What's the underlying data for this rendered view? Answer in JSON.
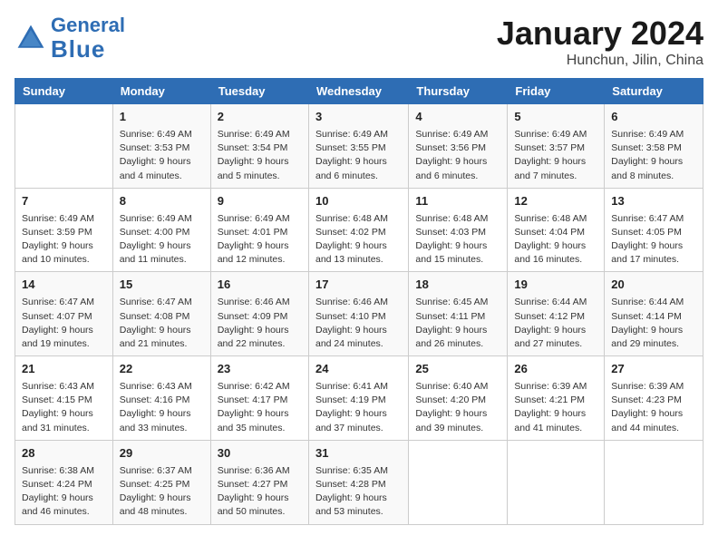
{
  "header": {
    "logo_line1": "General",
    "logo_line2": "Blue",
    "month_year": "January 2024",
    "location": "Hunchun, Jilin, China"
  },
  "weekdays": [
    "Sunday",
    "Monday",
    "Tuesday",
    "Wednesday",
    "Thursday",
    "Friday",
    "Saturday"
  ],
  "weeks": [
    [
      {
        "day": "",
        "sunrise": "",
        "sunset": "",
        "daylight": ""
      },
      {
        "day": "1",
        "sunrise": "Sunrise: 6:49 AM",
        "sunset": "Sunset: 3:53 PM",
        "daylight": "Daylight: 9 hours and 4 minutes."
      },
      {
        "day": "2",
        "sunrise": "Sunrise: 6:49 AM",
        "sunset": "Sunset: 3:54 PM",
        "daylight": "Daylight: 9 hours and 5 minutes."
      },
      {
        "day": "3",
        "sunrise": "Sunrise: 6:49 AM",
        "sunset": "Sunset: 3:55 PM",
        "daylight": "Daylight: 9 hours and 6 minutes."
      },
      {
        "day": "4",
        "sunrise": "Sunrise: 6:49 AM",
        "sunset": "Sunset: 3:56 PM",
        "daylight": "Daylight: 9 hours and 6 minutes."
      },
      {
        "day": "5",
        "sunrise": "Sunrise: 6:49 AM",
        "sunset": "Sunset: 3:57 PM",
        "daylight": "Daylight: 9 hours and 7 minutes."
      },
      {
        "day": "6",
        "sunrise": "Sunrise: 6:49 AM",
        "sunset": "Sunset: 3:58 PM",
        "daylight": "Daylight: 9 hours and 8 minutes."
      }
    ],
    [
      {
        "day": "7",
        "sunrise": "Sunrise: 6:49 AM",
        "sunset": "Sunset: 3:59 PM",
        "daylight": "Daylight: 9 hours and 10 minutes."
      },
      {
        "day": "8",
        "sunrise": "Sunrise: 6:49 AM",
        "sunset": "Sunset: 4:00 PM",
        "daylight": "Daylight: 9 hours and 11 minutes."
      },
      {
        "day": "9",
        "sunrise": "Sunrise: 6:49 AM",
        "sunset": "Sunset: 4:01 PM",
        "daylight": "Daylight: 9 hours and 12 minutes."
      },
      {
        "day": "10",
        "sunrise": "Sunrise: 6:48 AM",
        "sunset": "Sunset: 4:02 PM",
        "daylight": "Daylight: 9 hours and 13 minutes."
      },
      {
        "day": "11",
        "sunrise": "Sunrise: 6:48 AM",
        "sunset": "Sunset: 4:03 PM",
        "daylight": "Daylight: 9 hours and 15 minutes."
      },
      {
        "day": "12",
        "sunrise": "Sunrise: 6:48 AM",
        "sunset": "Sunset: 4:04 PM",
        "daylight": "Daylight: 9 hours and 16 minutes."
      },
      {
        "day": "13",
        "sunrise": "Sunrise: 6:47 AM",
        "sunset": "Sunset: 4:05 PM",
        "daylight": "Daylight: 9 hours and 17 minutes."
      }
    ],
    [
      {
        "day": "14",
        "sunrise": "Sunrise: 6:47 AM",
        "sunset": "Sunset: 4:07 PM",
        "daylight": "Daylight: 9 hours and 19 minutes."
      },
      {
        "day": "15",
        "sunrise": "Sunrise: 6:47 AM",
        "sunset": "Sunset: 4:08 PM",
        "daylight": "Daylight: 9 hours and 21 minutes."
      },
      {
        "day": "16",
        "sunrise": "Sunrise: 6:46 AM",
        "sunset": "Sunset: 4:09 PM",
        "daylight": "Daylight: 9 hours and 22 minutes."
      },
      {
        "day": "17",
        "sunrise": "Sunrise: 6:46 AM",
        "sunset": "Sunset: 4:10 PM",
        "daylight": "Daylight: 9 hours and 24 minutes."
      },
      {
        "day": "18",
        "sunrise": "Sunrise: 6:45 AM",
        "sunset": "Sunset: 4:11 PM",
        "daylight": "Daylight: 9 hours and 26 minutes."
      },
      {
        "day": "19",
        "sunrise": "Sunrise: 6:44 AM",
        "sunset": "Sunset: 4:12 PM",
        "daylight": "Daylight: 9 hours and 27 minutes."
      },
      {
        "day": "20",
        "sunrise": "Sunrise: 6:44 AM",
        "sunset": "Sunset: 4:14 PM",
        "daylight": "Daylight: 9 hours and 29 minutes."
      }
    ],
    [
      {
        "day": "21",
        "sunrise": "Sunrise: 6:43 AM",
        "sunset": "Sunset: 4:15 PM",
        "daylight": "Daylight: 9 hours and 31 minutes."
      },
      {
        "day": "22",
        "sunrise": "Sunrise: 6:43 AM",
        "sunset": "Sunset: 4:16 PM",
        "daylight": "Daylight: 9 hours and 33 minutes."
      },
      {
        "day": "23",
        "sunrise": "Sunrise: 6:42 AM",
        "sunset": "Sunset: 4:17 PM",
        "daylight": "Daylight: 9 hours and 35 minutes."
      },
      {
        "day": "24",
        "sunrise": "Sunrise: 6:41 AM",
        "sunset": "Sunset: 4:19 PM",
        "daylight": "Daylight: 9 hours and 37 minutes."
      },
      {
        "day": "25",
        "sunrise": "Sunrise: 6:40 AM",
        "sunset": "Sunset: 4:20 PM",
        "daylight": "Daylight: 9 hours and 39 minutes."
      },
      {
        "day": "26",
        "sunrise": "Sunrise: 6:39 AM",
        "sunset": "Sunset: 4:21 PM",
        "daylight": "Daylight: 9 hours and 41 minutes."
      },
      {
        "day": "27",
        "sunrise": "Sunrise: 6:39 AM",
        "sunset": "Sunset: 4:23 PM",
        "daylight": "Daylight: 9 hours and 44 minutes."
      }
    ],
    [
      {
        "day": "28",
        "sunrise": "Sunrise: 6:38 AM",
        "sunset": "Sunset: 4:24 PM",
        "daylight": "Daylight: 9 hours and 46 minutes."
      },
      {
        "day": "29",
        "sunrise": "Sunrise: 6:37 AM",
        "sunset": "Sunset: 4:25 PM",
        "daylight": "Daylight: 9 hours and 48 minutes."
      },
      {
        "day": "30",
        "sunrise": "Sunrise: 6:36 AM",
        "sunset": "Sunset: 4:27 PM",
        "daylight": "Daylight: 9 hours and 50 minutes."
      },
      {
        "day": "31",
        "sunrise": "Sunrise: 6:35 AM",
        "sunset": "Sunset: 4:28 PM",
        "daylight": "Daylight: 9 hours and 53 minutes."
      },
      {
        "day": "",
        "sunrise": "",
        "sunset": "",
        "daylight": ""
      },
      {
        "day": "",
        "sunrise": "",
        "sunset": "",
        "daylight": ""
      },
      {
        "day": "",
        "sunrise": "",
        "sunset": "",
        "daylight": ""
      }
    ]
  ]
}
